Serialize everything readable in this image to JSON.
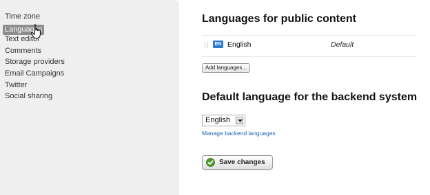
{
  "sidebar": {
    "items": [
      {
        "label": "Time zone"
      },
      {
        "label": "Languages"
      },
      {
        "label": "Text editor"
      },
      {
        "label": "Comments"
      },
      {
        "label": "Storage providers"
      },
      {
        "label": "Email Campaigns"
      },
      {
        "label": "Twitter"
      },
      {
        "label": "Social sharing"
      }
    ],
    "active_index": 1
  },
  "public_languages": {
    "title": "Languages for public content",
    "rows": [
      {
        "flag_code": "EN",
        "name": "English",
        "status": "Default"
      }
    ],
    "add_button_label": "Add languages..."
  },
  "backend_language": {
    "title": "Default language for the backend system",
    "selected": "English",
    "manage_link": "Manage backend languages"
  },
  "actions": {
    "save_label": "Save changes"
  },
  "colors": {
    "sidebar_bg": "#efefef",
    "active_item_bg": "#8d8d8d",
    "flag_blue": "#2f7ad1",
    "link_blue": "#1f62b4",
    "check_green": "#4a9a2a"
  },
  "icons": {
    "cursor": "hand-pointer-icon",
    "save": "check-icon",
    "select": "chevron-down-icon",
    "drag": "drag-handle-icon"
  }
}
